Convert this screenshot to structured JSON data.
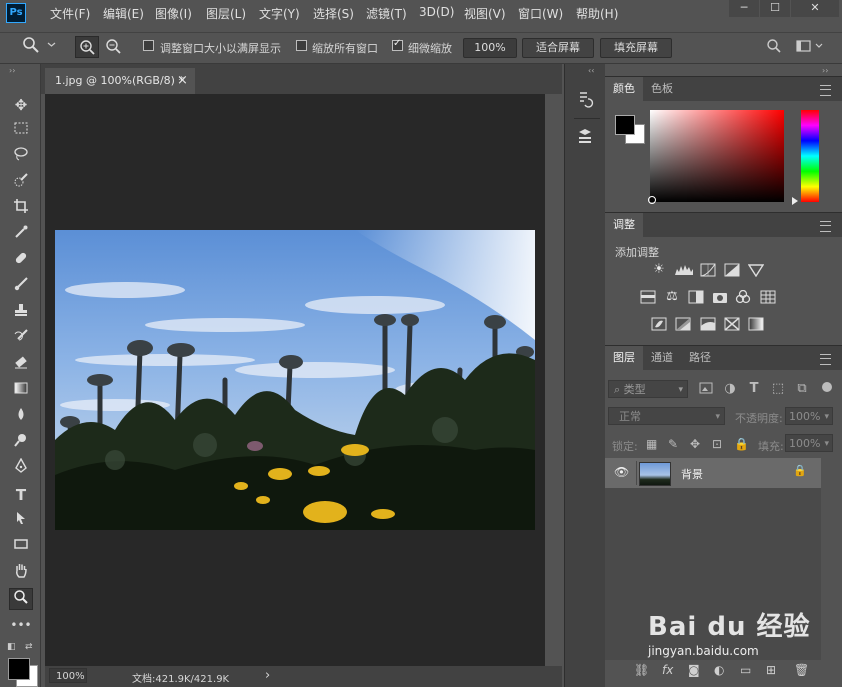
{
  "app": {
    "logo": "Ps"
  },
  "menu": [
    "文件(F)",
    "编辑(E)",
    "图像(I)",
    "图层(L)",
    "文字(Y)",
    "选择(S)",
    "滤镜(T)",
    "3D(D)",
    "视图(V)",
    "窗口(W)",
    "帮助(H)"
  ],
  "window_controls": {
    "minimize": "─",
    "maximize": "☐",
    "close": "✕"
  },
  "options": {
    "resize_windows": "调整窗口大小以满屏显示",
    "zoom_all": "缩放所有窗口",
    "scrubby_zoom": "细微缩放",
    "zoom_value": "100%",
    "fit_screen": "适合屏幕",
    "fill_screen": "填充屏幕",
    "resize_checked": false,
    "zoom_all_checked": false,
    "scrubby_checked": true
  },
  "document": {
    "tab_title": "1.jpg @ 100%(RGB/8) *",
    "tab_close": "×",
    "zoom": "100%",
    "doc_info": "文档:421.9K/421.9K",
    "status_arrow": "›"
  },
  "panels": {
    "color": {
      "tabs": [
        "颜色",
        "色板"
      ],
      "fg": "#000000",
      "bg": "#ffffff",
      "hue": "#ff0000"
    },
    "adjustments": {
      "tab": "调整",
      "label": "添加调整"
    },
    "layers": {
      "tabs": [
        "图层",
        "通道",
        "路径"
      ],
      "filter_kind": "类型",
      "blend_mode": "正常",
      "opacity_label": "不透明度:",
      "opacity_value": "100%",
      "lock_label": "锁定:",
      "fill_label": "填充:",
      "fill_value": "100%",
      "layer_name": "背景"
    }
  },
  "watermark": {
    "brand": "Bai du 经验",
    "url": "jingyan.baidu.com"
  }
}
